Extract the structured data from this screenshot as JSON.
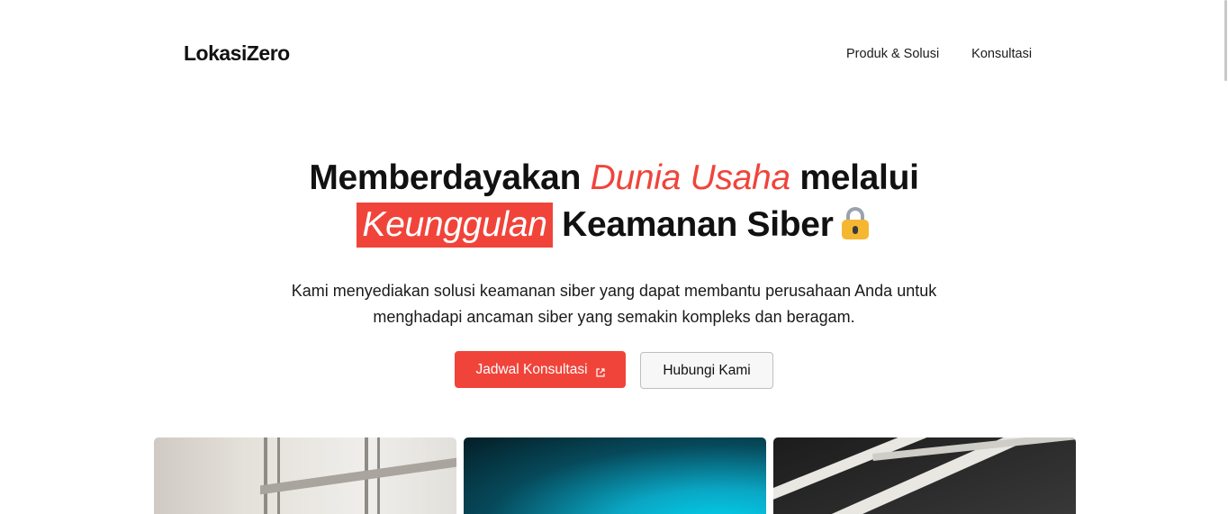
{
  "brand": {
    "name": "LokasiZero"
  },
  "nav": {
    "items": [
      {
        "label": "Produk & Solusi"
      },
      {
        "label": "Konsultasi"
      }
    ]
  },
  "hero": {
    "headline": {
      "part1": "Memberdayakan ",
      "highlight1": "Dunia Usaha",
      "part2": " melalui",
      "highlight2": "Keunggulan",
      "part3": " Keamanan Siber"
    },
    "subtitle": "Kami menyediakan solusi keamanan siber yang dapat membantu perusahaan Anda untuk menghadapi ancaman siber yang semakin kompleks dan beragam.",
    "primary_button": "Jadwal Konsultasi",
    "secondary_button": "Hubungi Kami"
  },
  "icons": {
    "lock": "lock-emoji-icon",
    "external_link": "external-link-icon"
  },
  "colors": {
    "accent": "#f0443a",
    "text": "#111111",
    "background": "#ffffff"
  }
}
